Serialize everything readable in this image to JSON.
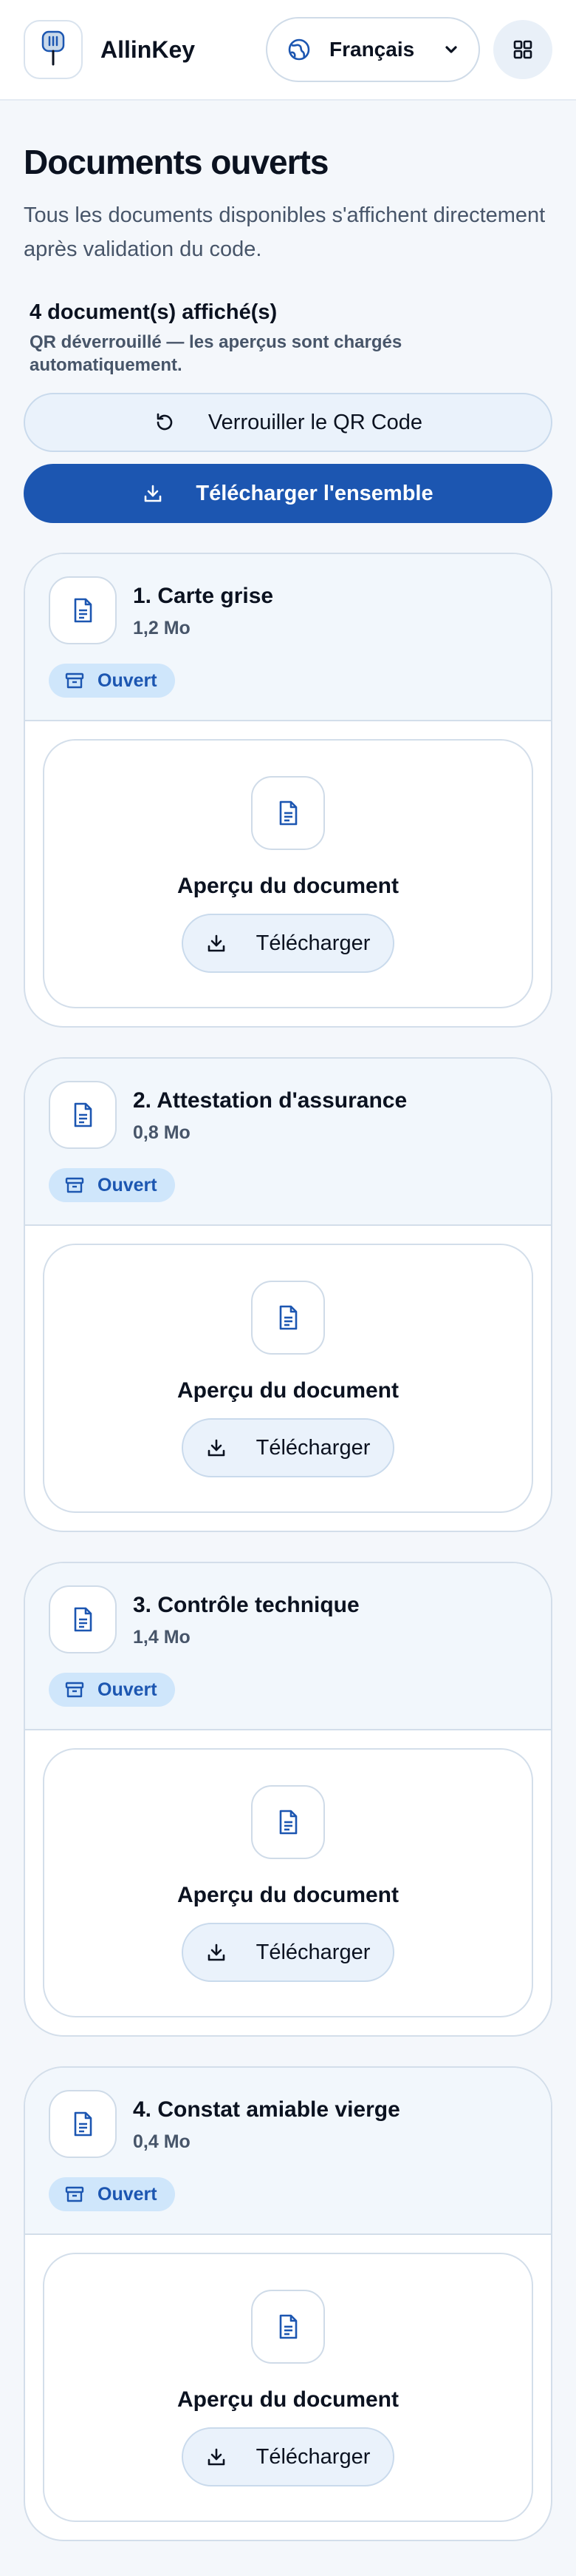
{
  "header": {
    "app_name": "AllinKey",
    "language": "Français",
    "icons": {
      "logo": "key-tag-icon",
      "language": "globe-icon",
      "dropdown": "chevron-down-icon",
      "apps": "grid-icon"
    }
  },
  "page": {
    "title": "Documents ouverts",
    "description": "Tous les documents disponibles s'affichent directement après validation du code.",
    "count_text": "4 document(s) affiché(s)",
    "unlocked_note": "QR déverrouillé — les aperçus sont chargés automatiquement."
  },
  "actions": {
    "lock_label": "Verrouiller le QR Code",
    "download_all_label": "Télécharger l'ensemble",
    "lock_icon": "rotate-ccw-icon",
    "download_icon": "download-icon"
  },
  "documents": [
    {
      "title": "1. Carte grise",
      "size": "1,2 Mo",
      "status": "Ouvert",
      "preview_label": "Aperçu du document",
      "download_label": "Télécharger"
    },
    {
      "title": "2. Attestation d'assurance",
      "size": "0,8 Mo",
      "status": "Ouvert",
      "preview_label": "Aperçu du document",
      "download_label": "Télécharger"
    },
    {
      "title": "3. Contrôle technique",
      "size": "1,4 Mo",
      "status": "Ouvert",
      "preview_label": "Aperçu du document",
      "download_label": "Télécharger"
    },
    {
      "title": "4. Constat amiable vierge",
      "size": "0,4 Mo",
      "status": "Ouvert",
      "preview_label": "Aperçu du document",
      "download_label": "Télécharger"
    }
  ],
  "colors": {
    "primary": "#1c56b1",
    "badge_bg": "#cfe6fb",
    "card_head_bg": "#f2f7fc",
    "page_bg": "#f4f7fb"
  }
}
